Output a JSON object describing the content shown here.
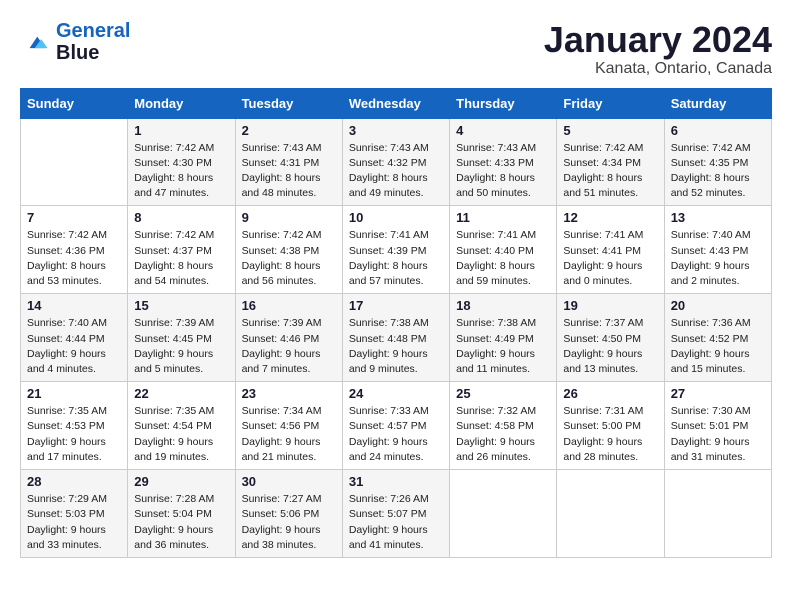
{
  "header": {
    "logo_line1": "General",
    "logo_line2": "Blue",
    "month": "January 2024",
    "location": "Kanata, Ontario, Canada"
  },
  "days_of_week": [
    "Sunday",
    "Monday",
    "Tuesday",
    "Wednesday",
    "Thursday",
    "Friday",
    "Saturday"
  ],
  "weeks": [
    [
      {
        "num": "",
        "info": ""
      },
      {
        "num": "1",
        "info": "Sunrise: 7:42 AM\nSunset: 4:30 PM\nDaylight: 8 hours\nand 47 minutes."
      },
      {
        "num": "2",
        "info": "Sunrise: 7:43 AM\nSunset: 4:31 PM\nDaylight: 8 hours\nand 48 minutes."
      },
      {
        "num": "3",
        "info": "Sunrise: 7:43 AM\nSunset: 4:32 PM\nDaylight: 8 hours\nand 49 minutes."
      },
      {
        "num": "4",
        "info": "Sunrise: 7:43 AM\nSunset: 4:33 PM\nDaylight: 8 hours\nand 50 minutes."
      },
      {
        "num": "5",
        "info": "Sunrise: 7:42 AM\nSunset: 4:34 PM\nDaylight: 8 hours\nand 51 minutes."
      },
      {
        "num": "6",
        "info": "Sunrise: 7:42 AM\nSunset: 4:35 PM\nDaylight: 8 hours\nand 52 minutes."
      }
    ],
    [
      {
        "num": "7",
        "info": "Sunrise: 7:42 AM\nSunset: 4:36 PM\nDaylight: 8 hours\nand 53 minutes."
      },
      {
        "num": "8",
        "info": "Sunrise: 7:42 AM\nSunset: 4:37 PM\nDaylight: 8 hours\nand 54 minutes."
      },
      {
        "num": "9",
        "info": "Sunrise: 7:42 AM\nSunset: 4:38 PM\nDaylight: 8 hours\nand 56 minutes."
      },
      {
        "num": "10",
        "info": "Sunrise: 7:41 AM\nSunset: 4:39 PM\nDaylight: 8 hours\nand 57 minutes."
      },
      {
        "num": "11",
        "info": "Sunrise: 7:41 AM\nSunset: 4:40 PM\nDaylight: 8 hours\nand 59 minutes."
      },
      {
        "num": "12",
        "info": "Sunrise: 7:41 AM\nSunset: 4:41 PM\nDaylight: 9 hours\nand 0 minutes."
      },
      {
        "num": "13",
        "info": "Sunrise: 7:40 AM\nSunset: 4:43 PM\nDaylight: 9 hours\nand 2 minutes."
      }
    ],
    [
      {
        "num": "14",
        "info": "Sunrise: 7:40 AM\nSunset: 4:44 PM\nDaylight: 9 hours\nand 4 minutes."
      },
      {
        "num": "15",
        "info": "Sunrise: 7:39 AM\nSunset: 4:45 PM\nDaylight: 9 hours\nand 5 minutes."
      },
      {
        "num": "16",
        "info": "Sunrise: 7:39 AM\nSunset: 4:46 PM\nDaylight: 9 hours\nand 7 minutes."
      },
      {
        "num": "17",
        "info": "Sunrise: 7:38 AM\nSunset: 4:48 PM\nDaylight: 9 hours\nand 9 minutes."
      },
      {
        "num": "18",
        "info": "Sunrise: 7:38 AM\nSunset: 4:49 PM\nDaylight: 9 hours\nand 11 minutes."
      },
      {
        "num": "19",
        "info": "Sunrise: 7:37 AM\nSunset: 4:50 PM\nDaylight: 9 hours\nand 13 minutes."
      },
      {
        "num": "20",
        "info": "Sunrise: 7:36 AM\nSunset: 4:52 PM\nDaylight: 9 hours\nand 15 minutes."
      }
    ],
    [
      {
        "num": "21",
        "info": "Sunrise: 7:35 AM\nSunset: 4:53 PM\nDaylight: 9 hours\nand 17 minutes."
      },
      {
        "num": "22",
        "info": "Sunrise: 7:35 AM\nSunset: 4:54 PM\nDaylight: 9 hours\nand 19 minutes."
      },
      {
        "num": "23",
        "info": "Sunrise: 7:34 AM\nSunset: 4:56 PM\nDaylight: 9 hours\nand 21 minutes."
      },
      {
        "num": "24",
        "info": "Sunrise: 7:33 AM\nSunset: 4:57 PM\nDaylight: 9 hours\nand 24 minutes."
      },
      {
        "num": "25",
        "info": "Sunrise: 7:32 AM\nSunset: 4:58 PM\nDaylight: 9 hours\nand 26 minutes."
      },
      {
        "num": "26",
        "info": "Sunrise: 7:31 AM\nSunset: 5:00 PM\nDaylight: 9 hours\nand 28 minutes."
      },
      {
        "num": "27",
        "info": "Sunrise: 7:30 AM\nSunset: 5:01 PM\nDaylight: 9 hours\nand 31 minutes."
      }
    ],
    [
      {
        "num": "28",
        "info": "Sunrise: 7:29 AM\nSunset: 5:03 PM\nDaylight: 9 hours\nand 33 minutes."
      },
      {
        "num": "29",
        "info": "Sunrise: 7:28 AM\nSunset: 5:04 PM\nDaylight: 9 hours\nand 36 minutes."
      },
      {
        "num": "30",
        "info": "Sunrise: 7:27 AM\nSunset: 5:06 PM\nDaylight: 9 hours\nand 38 minutes."
      },
      {
        "num": "31",
        "info": "Sunrise: 7:26 AM\nSunset: 5:07 PM\nDaylight: 9 hours\nand 41 minutes."
      },
      {
        "num": "",
        "info": ""
      },
      {
        "num": "",
        "info": ""
      },
      {
        "num": "",
        "info": ""
      }
    ]
  ]
}
